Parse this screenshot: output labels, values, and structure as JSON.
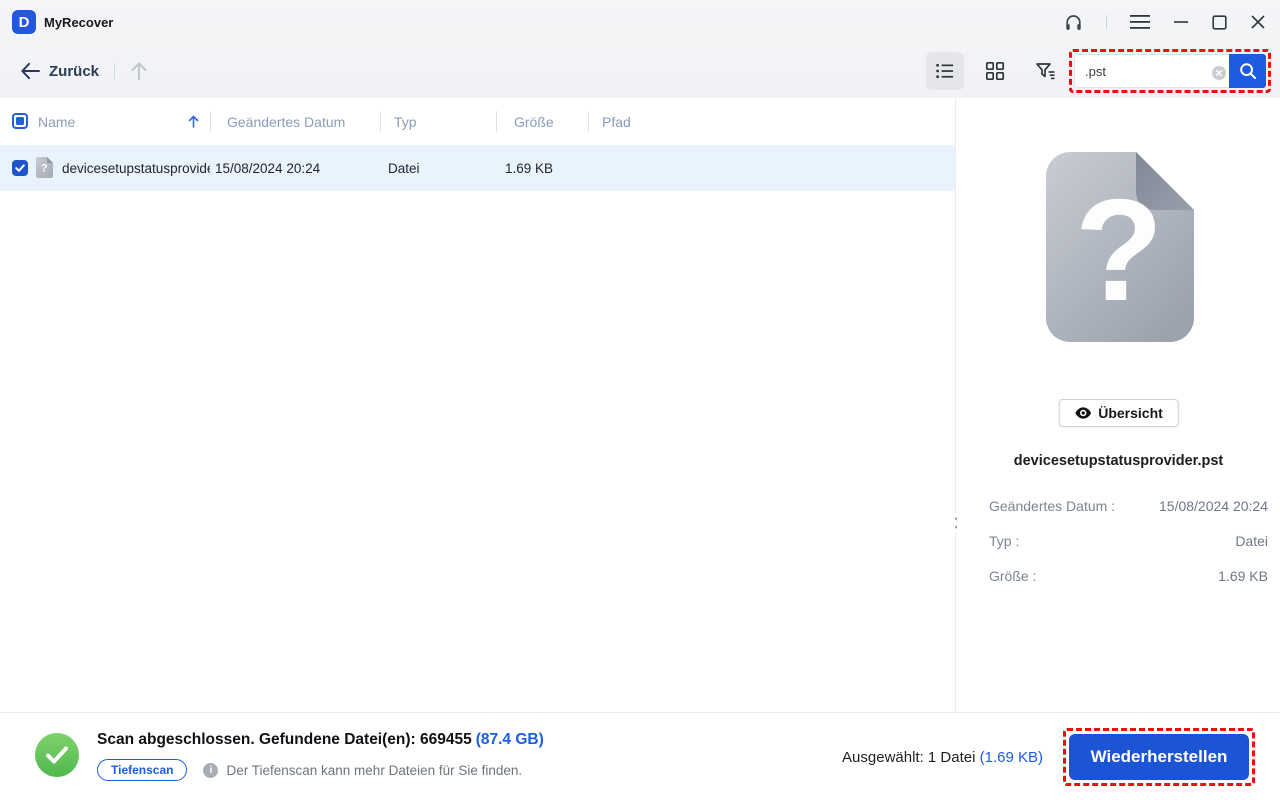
{
  "app": {
    "title": "MyRecover",
    "logo_letter": "D"
  },
  "toolbar": {
    "back_label": "Zurück",
    "search": {
      "value": ".pst"
    }
  },
  "table": {
    "columns": [
      "Name",
      "Geändertes Datum",
      "Typ",
      "Größe",
      "Pfad"
    ],
    "rows": [
      {
        "name": "devicesetupstatusprovide...",
        "modified": "15/08/2024 20:24",
        "type": "Datei",
        "size": "1.69 KB",
        "path": ""
      }
    ]
  },
  "preview": {
    "overview_label": "Übersicht",
    "filename": "devicesetupstatusprovider.pst",
    "file_glyph": "?",
    "details": [
      {
        "label": "Geändertes Datum :",
        "value": "15/08/2024 20:24"
      },
      {
        "label": "Typ :",
        "value": "Datei"
      },
      {
        "label": "Größe :",
        "value": "1.69 KB"
      }
    ]
  },
  "statusbar": {
    "scan_message": "Scan abgeschlossen. Gefundene Datei(en): 669455",
    "scan_size": "(87.4 GB)",
    "deep_scan_label": "Tiefenscan",
    "info_glyph": "i",
    "deep_scan_hint": "Der Tiefenscan kann mehr Dateien für Sie finden.",
    "selected_label": "Ausgewählt: 1 Datei",
    "selected_size": "(1.69 KB)",
    "recover_label": "Wiederherstellen"
  },
  "colors": {
    "accent_blue": "#1d5ce0",
    "link_blue": "#1b5ce8",
    "success_green": "#5cc355",
    "highlight_red": "#ed0f0f",
    "row_selected_bg": "#e9f3fd"
  },
  "icons": {
    "headset-icon": "headphones",
    "menu-icon": "hamburger",
    "minimize-icon": "–",
    "maximize-icon": "□",
    "close-icon": "×",
    "back-arrow-icon": "←",
    "up-arrow-icon": "↑",
    "list-view-icon": "list",
    "grid-view-icon": "grid",
    "filter-icon": "funnel",
    "clear-icon": "ⓧ",
    "search-icon": "magnifier",
    "sort-asc-icon": "↑",
    "file-unknown-icon": "? document",
    "eye-icon": "eye",
    "success-check-icon": "✓",
    "panel-collapse-icon": "›"
  }
}
